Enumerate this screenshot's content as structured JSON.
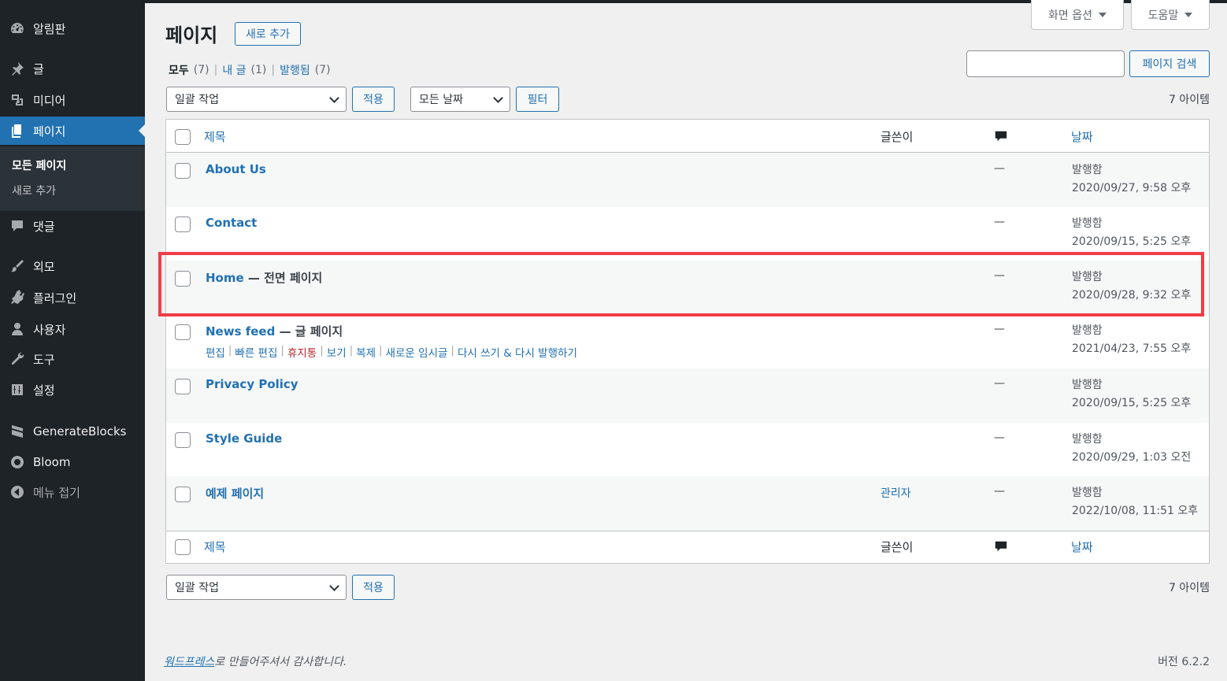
{
  "sidebar": {
    "dashboard": "알림판",
    "posts": "글",
    "media": "미디어",
    "pages": "페이지",
    "submenu_all": "모든 페이지",
    "submenu_add": "새로 추가",
    "comments": "댓글",
    "appearance": "외모",
    "plugins": "플러그인",
    "users": "사용자",
    "tools": "도구",
    "settings": "설정",
    "generateblocks": "GenerateBlocks",
    "bloom": "Bloom",
    "collapse": "메뉴 접기"
  },
  "header": {
    "title": "페이지",
    "add_new": "새로 추가",
    "screen_options": "화면 옵션",
    "help": "도움말"
  },
  "filters": {
    "all_label": "모두",
    "all_count": "(7)",
    "mine_label": "내 글",
    "mine_count": "(1)",
    "published_label": "발행됨",
    "published_count": "(7)",
    "sep": "|",
    "search_button": "페이지 검색",
    "bulk_action": "일괄 작업",
    "apply": "적용",
    "all_dates": "모든 날짜",
    "filter": "필터",
    "item_count": "7 아이템"
  },
  "table": {
    "col_title": "제목",
    "col_author": "글쓴이",
    "col_date": "날짜",
    "rows": [
      {
        "title": "About Us",
        "state": "",
        "author": "",
        "comments": "—",
        "status": "발행함",
        "date": "2020/09/27, 9:58 오후"
      },
      {
        "title": "Contact",
        "state": "",
        "author": "",
        "comments": "—",
        "status": "발행함",
        "date": "2020/09/15, 5:25 오후"
      },
      {
        "title": "Home",
        "state": " — 전면 페이지",
        "author": "",
        "comments": "—",
        "status": "발행함",
        "date": "2020/09/28, 9:32 오후"
      },
      {
        "title": "News feed",
        "state": " — 글 페이지",
        "author": "",
        "comments": "—",
        "status": "발행함",
        "date": "2021/04/23, 7:55 오후"
      },
      {
        "title": "Privacy Policy",
        "state": "",
        "author": "",
        "comments": "—",
        "status": "발행함",
        "date": "2020/09/15, 5:25 오후"
      },
      {
        "title": "Style Guide",
        "state": "",
        "author": "",
        "comments": "—",
        "status": "발행함",
        "date": "2020/09/29, 1:03 오전"
      },
      {
        "title": "예제 페이지",
        "state": "",
        "author": "관리자",
        "comments": "—",
        "status": "발행함",
        "date": "2022/10/08, 11:51 오후"
      }
    ],
    "row_actions": {
      "edit": "편집",
      "quick_edit": "빠른 편집",
      "trash": "휴지통",
      "view": "보기",
      "duplicate": "복제",
      "new_draft": "새로운 임시글",
      "rewrite": "다시 쓰기 & 다시 발행하기"
    }
  },
  "footer": {
    "wordpress_link": "워드프레스",
    "thanks": "로 만들어주셔서 감사합니다.",
    "version": "버전 6.2.2"
  },
  "colors": {
    "sidebar_bg": "#1d2327",
    "accent": "#2271b1",
    "highlight": "#f03c46",
    "trash": "#b32d2e"
  }
}
